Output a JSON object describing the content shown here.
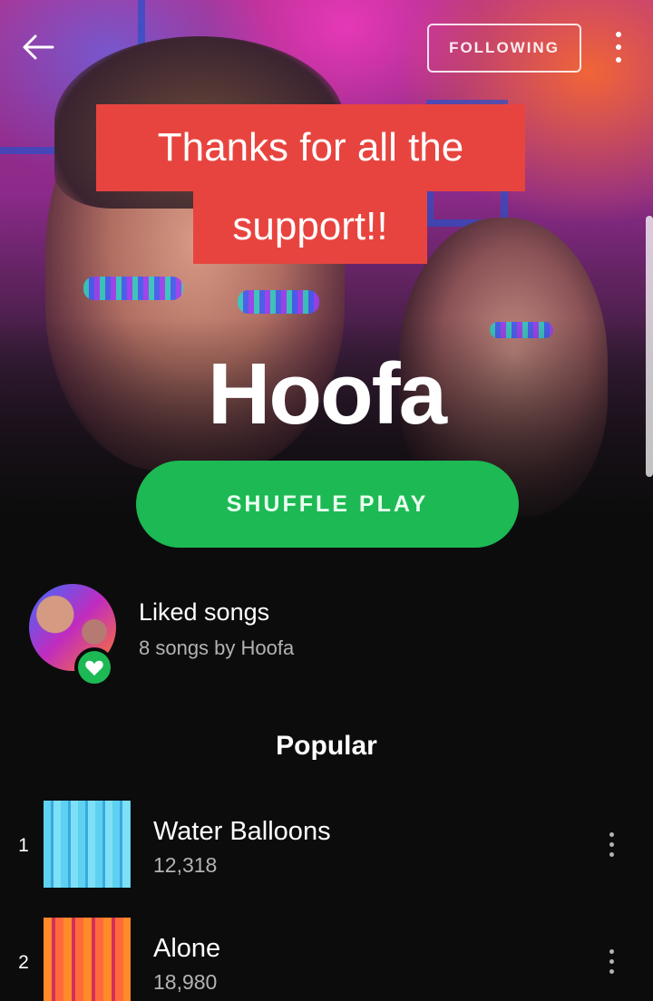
{
  "header": {
    "back_icon": "arrow-left-icon",
    "follow_label": "FOLLOWING",
    "more_icon": "more-vertical-icon"
  },
  "caption": {
    "line1": "Thanks for all the",
    "line2": "support!!"
  },
  "artist": {
    "name": "Hoofa"
  },
  "shuffle_label": "SHUFFLE PLAY",
  "liked": {
    "title": "Liked songs",
    "subtitle": "8 songs by Hoofa",
    "badge_icon": "heart-icon"
  },
  "popular": {
    "title": "Popular",
    "tracks": [
      {
        "num": "1",
        "title": "Water Balloons",
        "plays": "12,318"
      },
      {
        "num": "2",
        "title": "Alone",
        "plays": "18,980"
      }
    ]
  },
  "colors": {
    "accent": "#1db954",
    "caption_bg": "#e8443f",
    "background": "#0c0c0c"
  }
}
